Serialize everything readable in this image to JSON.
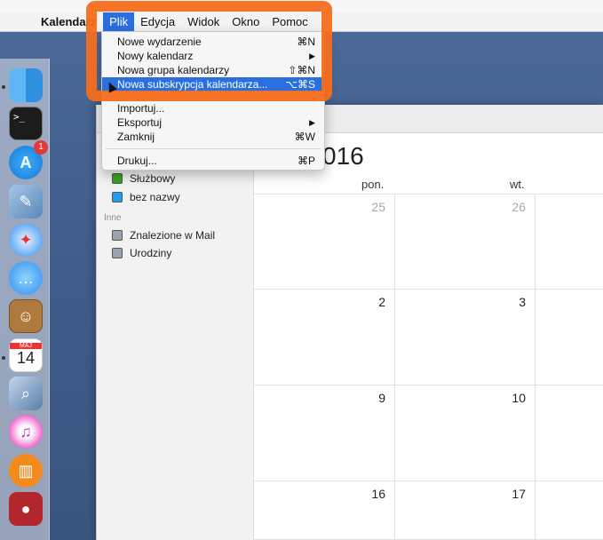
{
  "menubar": {
    "app_name": "Kalendarz",
    "menus": [
      "Plik",
      "Edycja",
      "Widok",
      "Okno",
      "Pomoc"
    ],
    "active_menu": "Plik"
  },
  "file_menu": {
    "items": [
      {
        "label": "Nowe wydarzenie",
        "shortcut": "⌘N"
      },
      {
        "label": "Nowy kalendarz",
        "shortcut": "▶"
      },
      {
        "label": "Nowa grupa kalendarzy",
        "shortcut": "⇧⌘N"
      },
      {
        "label": "Nowa subskrypcja kalendarza...",
        "shortcut": "⌥⌘S",
        "highlighted": true
      },
      {
        "label": "Importuj...",
        "shortcut": ""
      },
      {
        "label": "Eksportuj",
        "shortcut": "▶"
      },
      {
        "label": "Zamknij",
        "shortcut": "⌘W"
      },
      {
        "label": "Drukuj...",
        "shortcut": "⌘P"
      }
    ]
  },
  "dock": {
    "badge_count": "1",
    "calendar_month": "MAJ",
    "calendar_day": "14"
  },
  "sidebar": {
    "calendars": [
      {
        "label": "Służbowy",
        "color": "#34a61f"
      },
      {
        "label": "bez nazwy",
        "color": "#1f9ef0"
      }
    ],
    "other_section_label": "Inne",
    "other": [
      {
        "label": "Znalezione w Mail",
        "color": "#9aa3b0"
      },
      {
        "label": "Urodziny",
        "color": "#9aa3b0"
      }
    ]
  },
  "calendar": {
    "month_title_visible": "016",
    "day_headers": [
      "pon.",
      "wt."
    ],
    "weeks": [
      [
        "25",
        "26"
      ],
      [
        "2",
        "3"
      ],
      [
        "9",
        "10"
      ],
      [
        "16",
        "17"
      ]
    ]
  },
  "colors": {
    "highlight_orange": "#f46d1c",
    "selection_blue": "#2a6fe0"
  }
}
